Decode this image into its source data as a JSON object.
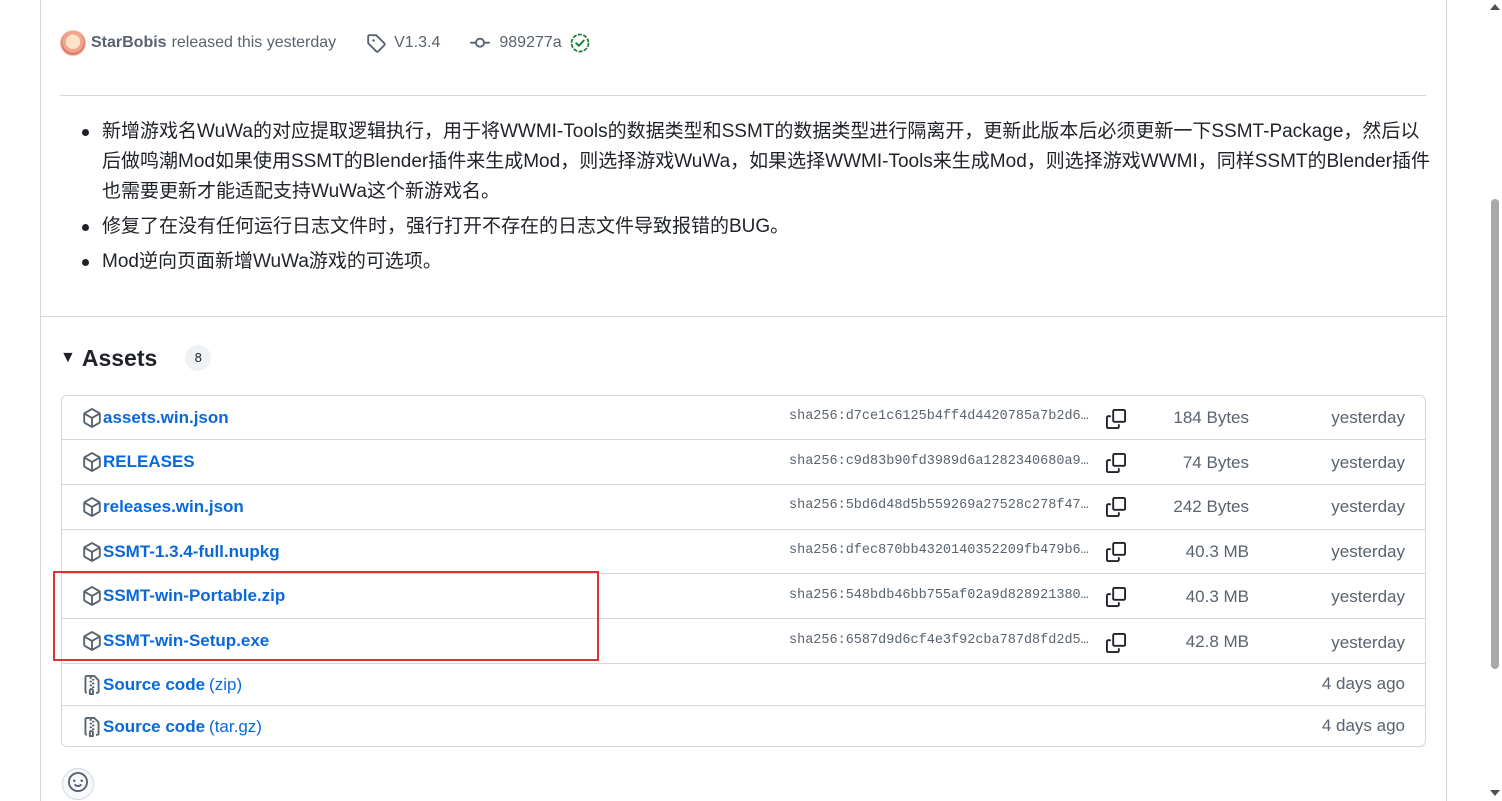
{
  "release": {
    "author": "StarBobis",
    "released_text": "released this yesterday",
    "tag": "V1.3.4",
    "commit": "989277a"
  },
  "notes": [
    "新增游戏名WuWa的对应提取逻辑执行，用于将WWMI-Tools的数据类型和SSMT的数据类型进行隔离开，更新此版本后必须更新一下SSMT-Package，然后以后做鸣潮Mod如果使用SSMT的Blender插件来生成Mod，则选择游戏WuWa，如果选择WWMI-Tools来生成Mod，则选择游戏WWMI，同样SSMT的Blender插件也需要更新才能适配支持WuWa这个新游戏名。",
    "修复了在没有任何运行日志文件时，强行打开不存在的日志文件导致报错的BUG。",
    "Mod逆向页面新增WuWa游戏的可选项。"
  ],
  "assets": {
    "title": "Assets",
    "count": "8",
    "items": [
      {
        "name": "assets.win.json",
        "sha": "sha256:d7ce1c6125b4ff4d4420785a7b2d6…",
        "size": "184 Bytes",
        "date": "yesterday"
      },
      {
        "name": "RELEASES",
        "sha": "sha256:c9d83b90fd3989d6a1282340680a9…",
        "size": "74 Bytes",
        "date": "yesterday"
      },
      {
        "name": "releases.win.json",
        "sha": "sha256:5bd6d48d5b559269a27528c278f47…",
        "size": "242 Bytes",
        "date": "yesterday"
      },
      {
        "name": "SSMT-1.3.4-full.nupkg",
        "sha": "sha256:dfec870bb4320140352209fb479b6…",
        "size": "40.3 MB",
        "date": "yesterday"
      },
      {
        "name": "SSMT-win-Portable.zip",
        "sha": "sha256:548bdb46bb755af02a9d828921380…",
        "size": "40.3 MB",
        "date": "yesterday"
      },
      {
        "name": "SSMT-win-Setup.exe",
        "sha": "sha256:6587d9d6cf4e3f92cba787d8fd2d5…",
        "size": "42.8 MB",
        "date": "yesterday"
      }
    ],
    "source": [
      {
        "name": "Source code",
        "suffix": "(zip)",
        "date": "4 days ago"
      },
      {
        "name": "Source code",
        "suffix": "(tar.gz)",
        "date": "4 days ago"
      }
    ]
  },
  "colors": {
    "link": "#0969da",
    "muted": "#59636e",
    "border": "#d1d9e0",
    "verified": "#1a7f37",
    "highlight": "#e03131"
  }
}
